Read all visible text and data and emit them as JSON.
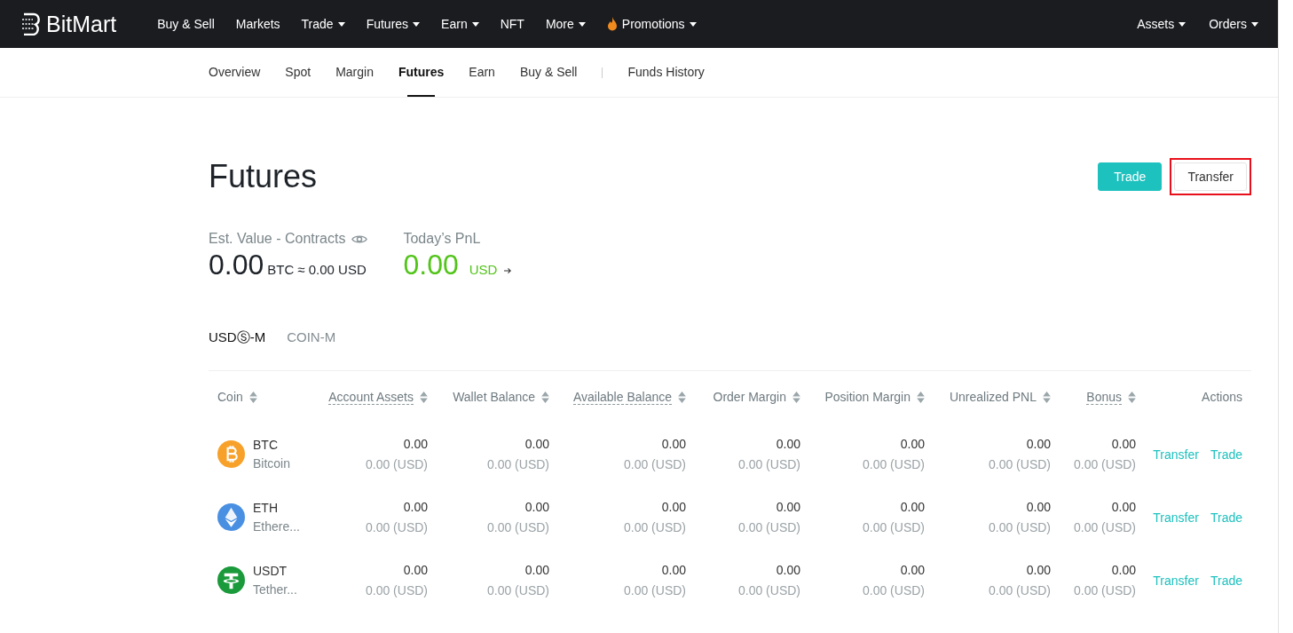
{
  "brand": {
    "name": "BitMart"
  },
  "top_nav": [
    {
      "label": "Buy & Sell",
      "dropdown": false,
      "kind": "link"
    },
    {
      "label": "Markets",
      "dropdown": false,
      "kind": "link"
    },
    {
      "label": "Trade",
      "dropdown": true,
      "kind": "link"
    },
    {
      "label": "Futures",
      "dropdown": true,
      "kind": "link"
    },
    {
      "label": "Earn",
      "dropdown": true,
      "kind": "link"
    },
    {
      "label": "NFT",
      "dropdown": false,
      "kind": "link"
    },
    {
      "label": "More",
      "dropdown": true,
      "kind": "link"
    },
    {
      "label": "Promotions",
      "dropdown": true,
      "kind": "promo"
    }
  ],
  "user_nav": [
    {
      "label": "Assets",
      "dropdown": true
    },
    {
      "label": "Orders",
      "dropdown": true
    }
  ],
  "sub_tabs": [
    {
      "label": "Overview",
      "selected": false,
      "separated": false
    },
    {
      "label": "Spot",
      "selected": false,
      "separated": false
    },
    {
      "label": "Margin",
      "selected": false,
      "separated": false
    },
    {
      "label": "Futures",
      "selected": true,
      "separated": false
    },
    {
      "label": "Earn",
      "selected": false,
      "separated": false
    },
    {
      "label": "Buy & Sell",
      "selected": false,
      "separated": false
    },
    {
      "label": "Funds History",
      "selected": false,
      "separated": true
    }
  ],
  "page_title": "Futures",
  "header_buttons": [
    {
      "label": "Trade",
      "kind": "primary",
      "highlighted": false
    },
    {
      "label": "Transfer",
      "kind": "secondary",
      "highlighted": true
    }
  ],
  "est_value": {
    "label": "Est. Value - Contracts",
    "amount": "0.00",
    "unit": "BTC",
    "approx": "≈ 0.00 USD"
  },
  "pnl": {
    "label": "Today’s PnL",
    "amount": "0.00",
    "unit": "USD"
  },
  "market_tabs": [
    {
      "label": "USDⓈ-M",
      "selected": true
    },
    {
      "label": "COIN-M",
      "selected": false
    }
  ],
  "table": {
    "columns": [
      {
        "label": "Coin",
        "sortable": true,
        "underlined": false
      },
      {
        "label": "Account Assets",
        "sortable": true,
        "underlined": true
      },
      {
        "label": "Wallet Balance",
        "sortable": true,
        "underlined": false
      },
      {
        "label": "Available Balance",
        "sortable": true,
        "underlined": true
      },
      {
        "label": "Order Margin",
        "sortable": true,
        "underlined": false
      },
      {
        "label": "Position Margin",
        "sortable": true,
        "underlined": false
      },
      {
        "label": "Unrealized PNL",
        "sortable": true,
        "underlined": false
      },
      {
        "label": "Bonus",
        "sortable": true,
        "underlined": true
      },
      {
        "label": "Actions",
        "sortable": false,
        "underlined": false
      }
    ],
    "rows": [
      {
        "cells": [
          {
            "kind": "coin",
            "symbol": "BTC",
            "name": "Bitcoin",
            "icon": {
              "kind": "btc",
              "color": "#f7a12b"
            }
          },
          {
            "kind": "amount",
            "value": "0.00",
            "usd": "0.00 (USD)"
          },
          {
            "kind": "amount",
            "value": "0.00",
            "usd": "0.00 (USD)"
          },
          {
            "kind": "amount",
            "value": "0.00",
            "usd": "0.00 (USD)"
          },
          {
            "kind": "amount",
            "value": "0.00",
            "usd": "0.00 (USD)"
          },
          {
            "kind": "amount",
            "value": "0.00",
            "usd": "0.00 (USD)"
          },
          {
            "kind": "amount",
            "value": "0.00",
            "usd": "0.00 (USD)"
          },
          {
            "kind": "amount",
            "value": "0.00",
            "usd": "0.00 (USD)"
          },
          {
            "kind": "actions",
            "actions": [
              "Transfer",
              "Trade"
            ]
          }
        ]
      },
      {
        "cells": [
          {
            "kind": "coin",
            "symbol": "ETH",
            "name": "Ethere...",
            "icon": {
              "kind": "eth",
              "color": "#4a90e2"
            }
          },
          {
            "kind": "amount",
            "value": "0.00",
            "usd": "0.00 (USD)"
          },
          {
            "kind": "amount",
            "value": "0.00",
            "usd": "0.00 (USD)"
          },
          {
            "kind": "amount",
            "value": "0.00",
            "usd": "0.00 (USD)"
          },
          {
            "kind": "amount",
            "value": "0.00",
            "usd": "0.00 (USD)"
          },
          {
            "kind": "amount",
            "value": "0.00",
            "usd": "0.00 (USD)"
          },
          {
            "kind": "amount",
            "value": "0.00",
            "usd": "0.00 (USD)"
          },
          {
            "kind": "amount",
            "value": "0.00",
            "usd": "0.00 (USD)"
          },
          {
            "kind": "actions",
            "actions": [
              "Transfer",
              "Trade"
            ]
          }
        ]
      },
      {
        "cells": [
          {
            "kind": "coin",
            "symbol": "USDT",
            "name": "Tether...",
            "icon": {
              "kind": "usdt",
              "color": "#1a9a3a"
            }
          },
          {
            "kind": "amount",
            "value": "0.00",
            "usd": "0.00 (USD)"
          },
          {
            "kind": "amount",
            "value": "0.00",
            "usd": "0.00 (USD)"
          },
          {
            "kind": "amount",
            "value": "0.00",
            "usd": "0.00 (USD)"
          },
          {
            "kind": "amount",
            "value": "0.00",
            "usd": "0.00 (USD)"
          },
          {
            "kind": "amount",
            "value": "0.00",
            "usd": "0.00 (USD)"
          },
          {
            "kind": "amount",
            "value": "0.00",
            "usd": "0.00 (USD)"
          },
          {
            "kind": "amount",
            "value": "0.00",
            "usd": "0.00 (USD)"
          },
          {
            "kind": "actions",
            "actions": [
              "Transfer",
              "Trade"
            ]
          }
        ]
      }
    ]
  }
}
